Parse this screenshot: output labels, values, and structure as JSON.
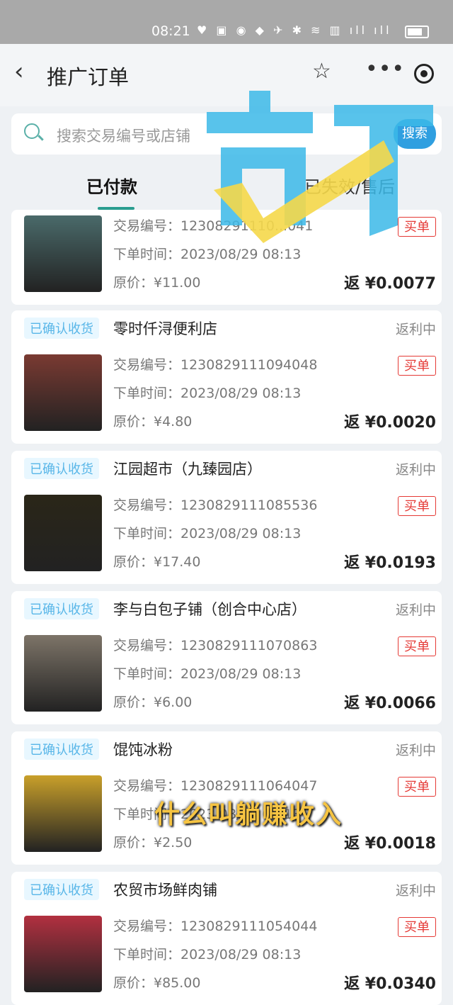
{
  "status_bar": {
    "time": "08:21",
    "icons": "♥ ▣ ◉ ◆   ✈ ✱ ≋ ▥ ıll ıll"
  },
  "header": {
    "title": "推广订单",
    "back_icon": "‹",
    "star_icon": "☆",
    "more_icon": "•••",
    "target_icon": "target-icon"
  },
  "search": {
    "placeholder": "搜索交易编号或店铺",
    "button": "搜索"
  },
  "tabs": [
    {
      "label": "已付款"
    },
    {
      "label": "已失效/售后"
    }
  ],
  "labels": {
    "order_no": "交易编号：",
    "order_time": "下单时间：",
    "price": "原价：",
    "tag": "买单",
    "rebate_prefix": "返 "
  },
  "orders": [
    {
      "badge": "",
      "store": "",
      "status": "",
      "order_no": "12308291110...041",
      "time": "2023/08/29 08:13",
      "price": "¥11.00",
      "rebate": "¥0.0077",
      "thumb": "#4a6a6a"
    },
    {
      "badge": "已确认收货",
      "store": "零时仟浔便利店",
      "status": "返利中",
      "order_no": "1230829111094048",
      "time": "2023/08/29 08:13",
      "price": "¥4.80",
      "rebate": "¥0.0020",
      "thumb": "#7a3a32"
    },
    {
      "badge": "已确认收货",
      "store": "江园超市（九臻园店）",
      "status": "返利中",
      "order_no": "1230829111085536",
      "time": "2023/08/29 08:13",
      "price": "¥17.40",
      "rebate": "¥0.0193",
      "thumb": "#2a2618"
    },
    {
      "badge": "已确认收货",
      "store": "李与白包子铺（创合中心店）",
      "status": "返利中",
      "order_no": "1230829111070863",
      "time": "2023/08/29 08:13",
      "price": "¥6.00",
      "rebate": "¥0.0066",
      "thumb": "#7d7468"
    },
    {
      "badge": "已确认收货",
      "store": "馄饨冰粉",
      "status": "返利中",
      "order_no": "1230829111064047",
      "time": "2023/08/29 08:13",
      "price": "¥2.50",
      "rebate": "¥0.0018",
      "thumb": "#c9a02a"
    },
    {
      "badge": "已确认收货",
      "store": "农贸市场鲜肉铺",
      "status": "返利中",
      "order_no": "1230829111054044",
      "time": "2023/08/29 08:13",
      "price": "¥85.00",
      "rebate": "¥0.0340",
      "thumb": "#b23040"
    }
  ],
  "overlay": {
    "caption": "什么叫躺赚收入",
    "logo_color": "#3bb8e8",
    "check_color": "#f5d84a"
  }
}
